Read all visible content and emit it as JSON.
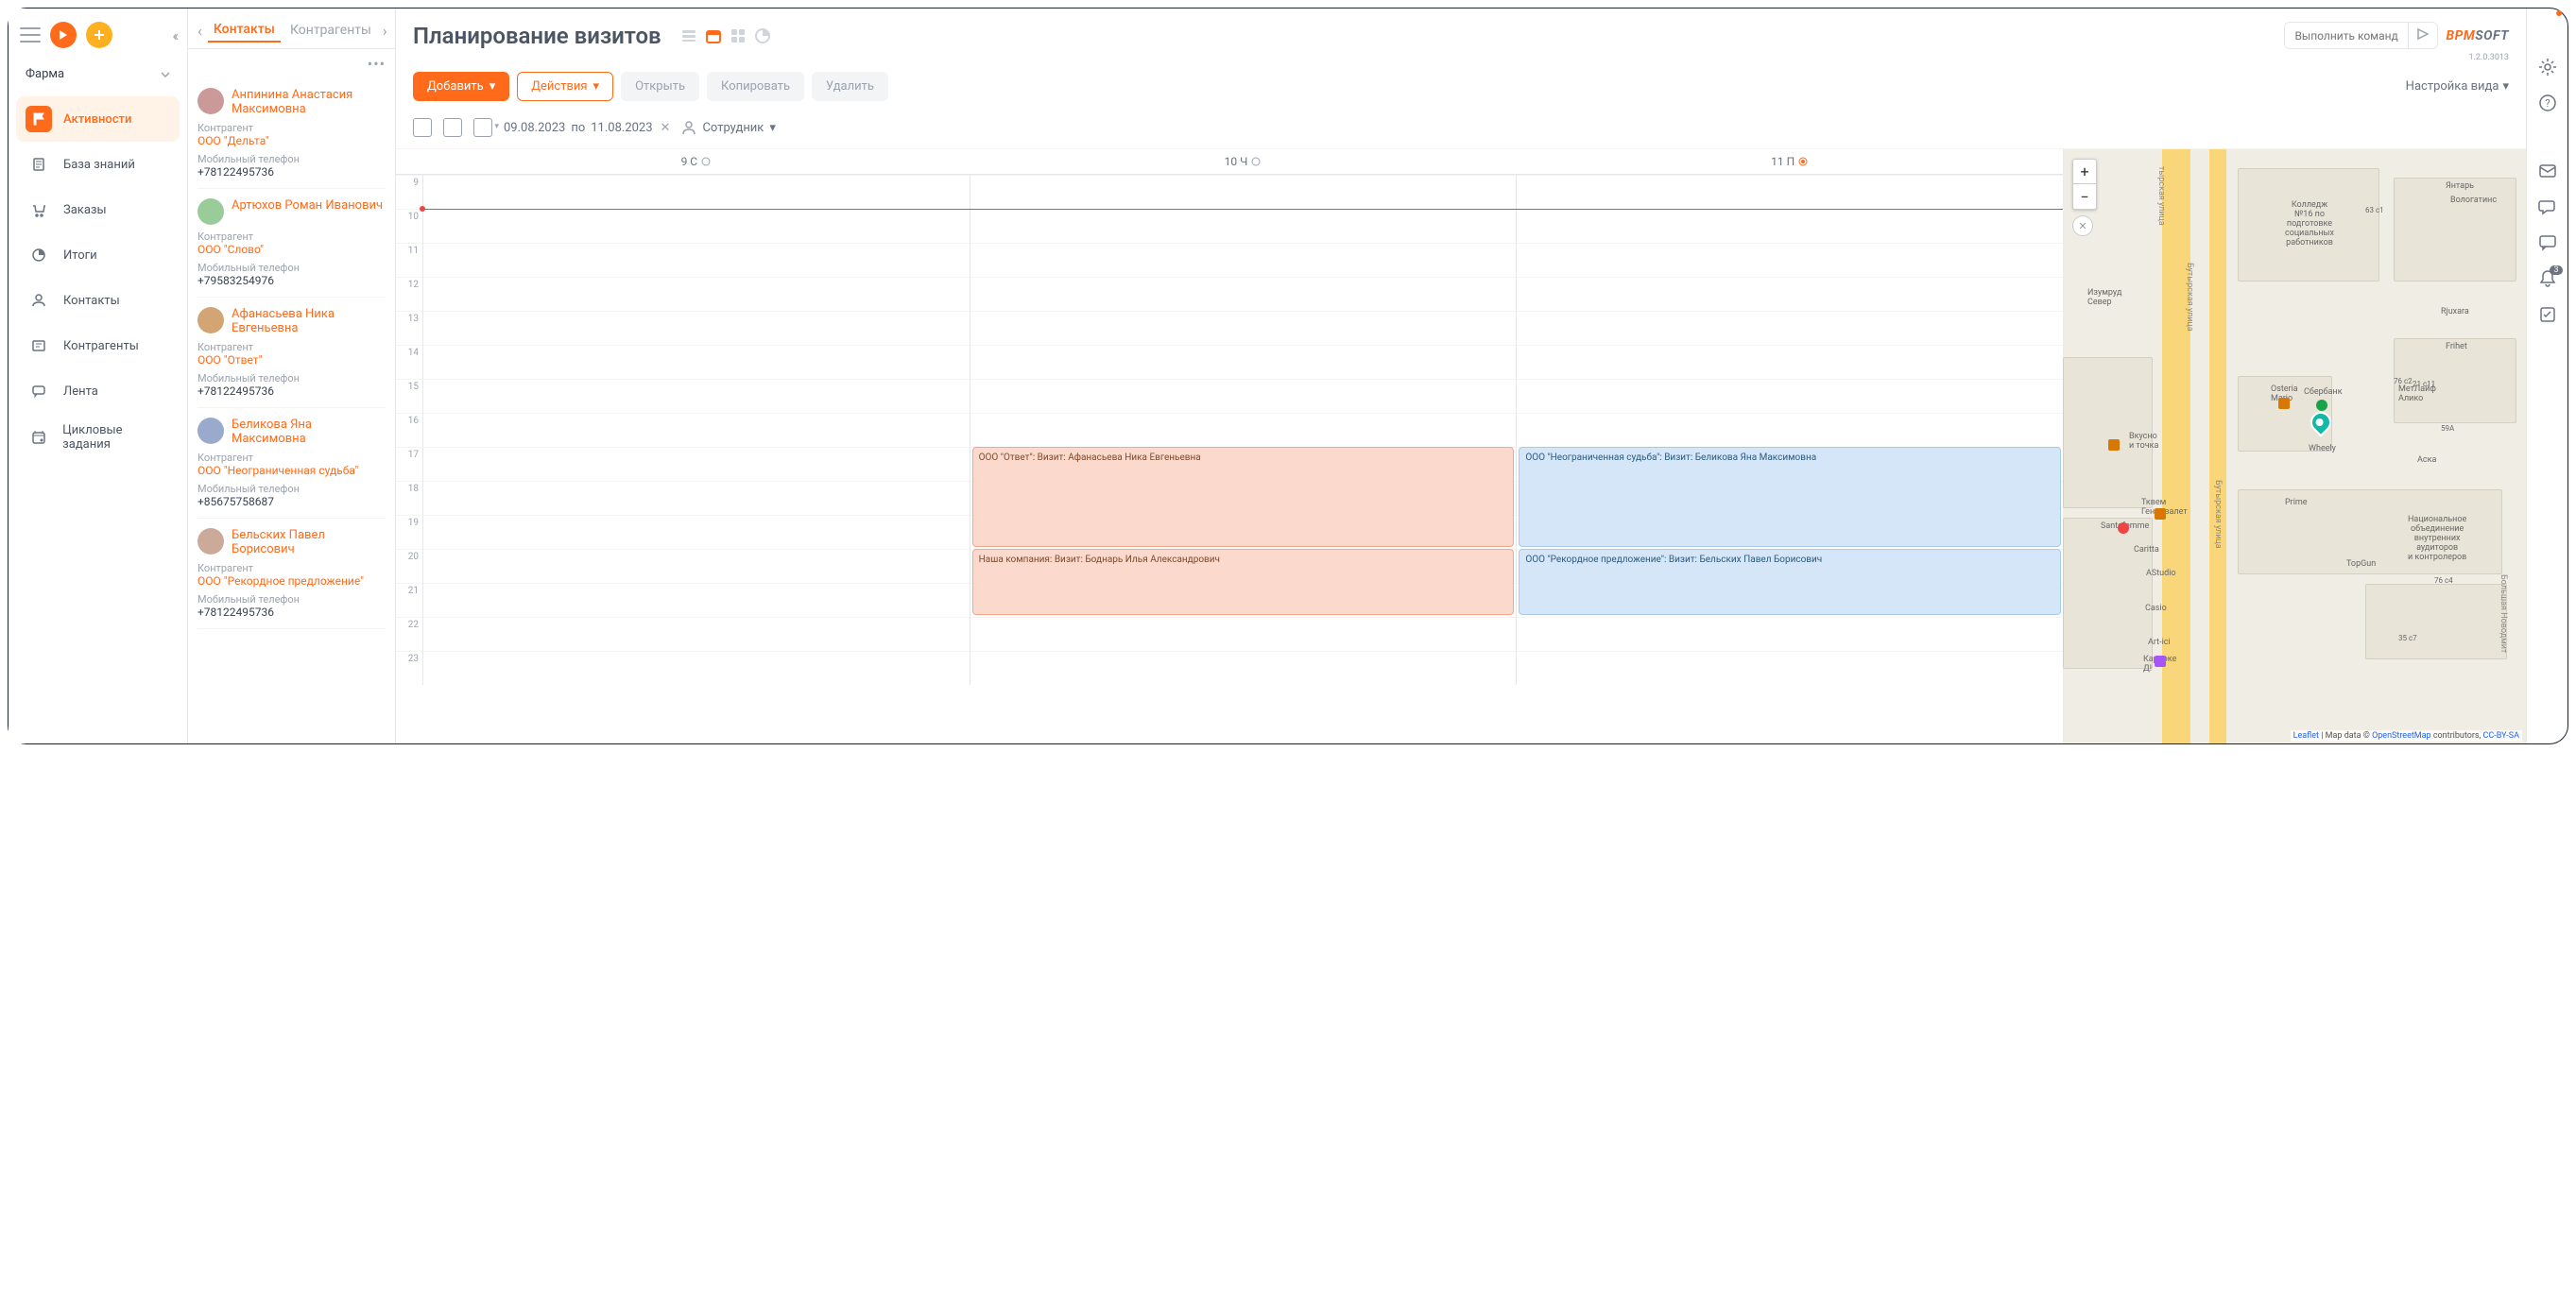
{
  "workspace": "Фарма",
  "nav": [
    {
      "label": "Активности",
      "active": true
    },
    {
      "label": "База знаний",
      "active": false
    },
    {
      "label": "Заказы",
      "active": false
    },
    {
      "label": "Итоги",
      "active": false
    },
    {
      "label": "Контакты",
      "active": false
    },
    {
      "label": "Контрагенты",
      "active": false
    },
    {
      "label": "Лента",
      "active": false
    },
    {
      "label": "Цикловые задания",
      "active": false
    }
  ],
  "contactTabs": {
    "active": "Контакты",
    "other": "Контрагенты"
  },
  "contactLabels": {
    "counterparty": "Контрагент",
    "mobile": "Мобильный телефон"
  },
  "contacts": [
    {
      "name": "Анпинина Анастасия Максимовна",
      "org": "ООО \"Дельта\"",
      "phone": "+78122495736"
    },
    {
      "name": "Артюхов Роман Иванович",
      "org": "ООО \"Слово\"",
      "phone": "+79583254976"
    },
    {
      "name": "Афанасьева Ника Евгеньевна",
      "org": "ООО \"Ответ\"",
      "phone": "+78122495736"
    },
    {
      "name": "Беликова Яна Максимовна",
      "org": "ООО \"Неограниченная судьба\"",
      "phone": "+85675758687"
    },
    {
      "name": "Бельских Павел Борисович",
      "org": "ООО \"Рекордное предложение\"",
      "phone": "+78122495736"
    }
  ],
  "page": {
    "title": "Планирование визитов",
    "version": "1.2.0.3013"
  },
  "cmd": {
    "placeholder": "Выполнить команду"
  },
  "logo": {
    "p1": "BPM",
    "p2": "SOFT"
  },
  "toolbar": {
    "add": "Добавить",
    "actions": "Действия",
    "open": "Открыть",
    "copy": "Копировать",
    "delete": "Удалить",
    "viewSetup": "Настройка вида"
  },
  "filters": {
    "from": "09.08.2023",
    "toLabel": "по",
    "to": "11.08.2023",
    "employee": "Сотрудник"
  },
  "calendar": {
    "days": [
      "9 С",
      "10 Ч",
      "11 П"
    ],
    "hours": [
      "9",
      "10",
      "11",
      "12",
      "13",
      "14",
      "15",
      "16",
      "17",
      "18",
      "19",
      "20",
      "21",
      "22",
      "23"
    ],
    "events": [
      {
        "day": 1,
        "startHour": 17,
        "endHour": 20,
        "color": "pink",
        "text": "ООО \"Ответ\": Визит: Афанасьева Ника Евгеньевна"
      },
      {
        "day": 2,
        "startHour": 17,
        "endHour": 20,
        "color": "blue",
        "text": "ООО \"Неограниченная судьба\": Визит: Беликова Яна Максимовна"
      },
      {
        "day": 1,
        "startHour": 20,
        "endHour": 22,
        "color": "pink",
        "text": "Наша компания: Визит: Боднарь Илья Александрович"
      },
      {
        "day": 2,
        "startHour": 20,
        "endHour": 22,
        "color": "blue",
        "text": "ООО \"Рекордное предложение\": Визит: Бельских Павел Борисович"
      }
    ]
  },
  "map": {
    "attribution": "Leaflet | Map data © OpenStreetMap contributors, CC-BY-SA"
  },
  "rightRail": {
    "notificationCount": "3"
  }
}
